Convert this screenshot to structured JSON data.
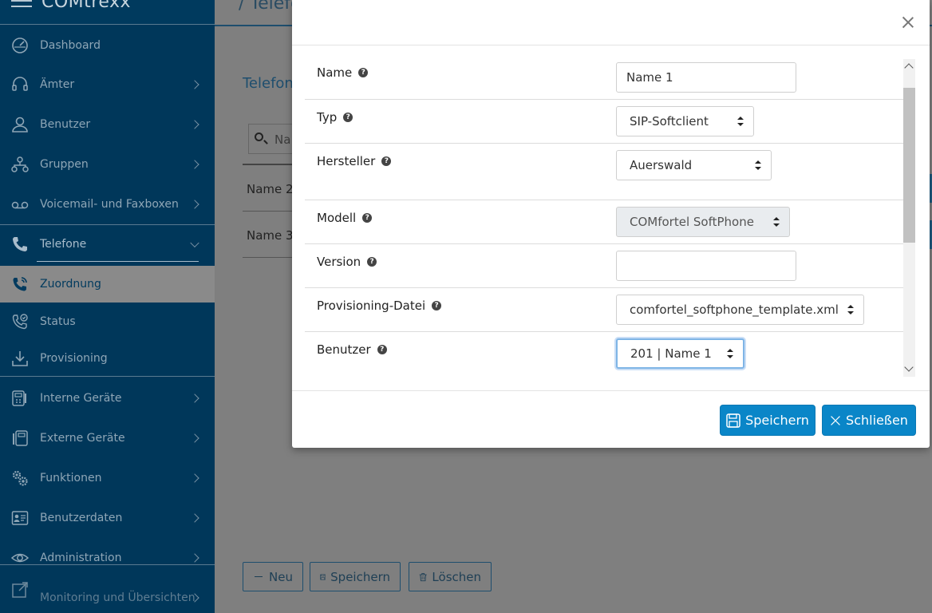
{
  "app": {
    "brand": "COMtrexx",
    "breadcrumb": "/ Telefo"
  },
  "sidebar": {
    "items": [
      {
        "label": "Dashboard",
        "icon": "dashboard-gauge-icon",
        "chevron": false
      },
      {
        "label": "Ämter",
        "icon": "headset-icon",
        "chevron": true
      },
      {
        "label": "Benutzer",
        "icon": "user-icon",
        "chevron": true
      },
      {
        "label": "Gruppen",
        "icon": "group-hierarchy-icon",
        "chevron": true
      },
      {
        "label": "Voicemail- und Faxboxen",
        "icon": "voicemail-icon",
        "chevron": true
      },
      {
        "label": "Telefone",
        "icon": "phone-icon",
        "chevron": true,
        "expanded": true
      },
      {
        "label": "Zuordnung",
        "icon": "phone-assign-icon",
        "chevron": false,
        "active": true
      },
      {
        "label": "Status",
        "icon": "phone-status-icon",
        "chevron": false
      },
      {
        "label": "Provisioning",
        "icon": "download-icon",
        "chevron": false
      },
      {
        "label": "Interne Geräte",
        "icon": "internal-device-icon",
        "chevron": true
      },
      {
        "label": "Externe Geräte",
        "icon": "external-device-icon",
        "chevron": true
      },
      {
        "label": "Funktionen",
        "icon": "gears-icon",
        "chevron": true
      },
      {
        "label": "Benutzerdaten",
        "icon": "contact-card-icon",
        "chevron": true
      },
      {
        "label": "Administration",
        "icon": "eye-icon",
        "chevron": true
      },
      {
        "label": "Monitoring und Übersichten",
        "icon": "monitoring-icon",
        "chevron": true
      }
    ]
  },
  "main": {
    "section_title": "Telefon",
    "search_placeholder": "Na",
    "rows": [
      "Name 2",
      "Name 3"
    ],
    "buttons": {
      "new": "Neu",
      "save": "Speichern",
      "delete": "Löschen"
    }
  },
  "modal": {
    "fields": {
      "name": {
        "label": "Name",
        "value": "Name 1"
      },
      "typ": {
        "label": "Typ",
        "value": "SIP-Softclient"
      },
      "hersteller": {
        "label": "Hersteller",
        "value": "Auerswald"
      },
      "modell": {
        "label": "Modell",
        "value": "COMfortel SoftPhone"
      },
      "version": {
        "label": "Version",
        "value": ""
      },
      "provisioning": {
        "label": "Provisioning-Datei",
        "value": "comfortel_softphone_template.xml"
      },
      "benutzer": {
        "label": "Benutzer",
        "value": "201 | Name 1"
      }
    },
    "help_glyph": "?",
    "save_label": "Speichern",
    "close_label": "Schließen"
  },
  "colors": {
    "accent": "#0a86c8",
    "sidebar": "#00375a",
    "overlay": "#7f7f7f"
  }
}
